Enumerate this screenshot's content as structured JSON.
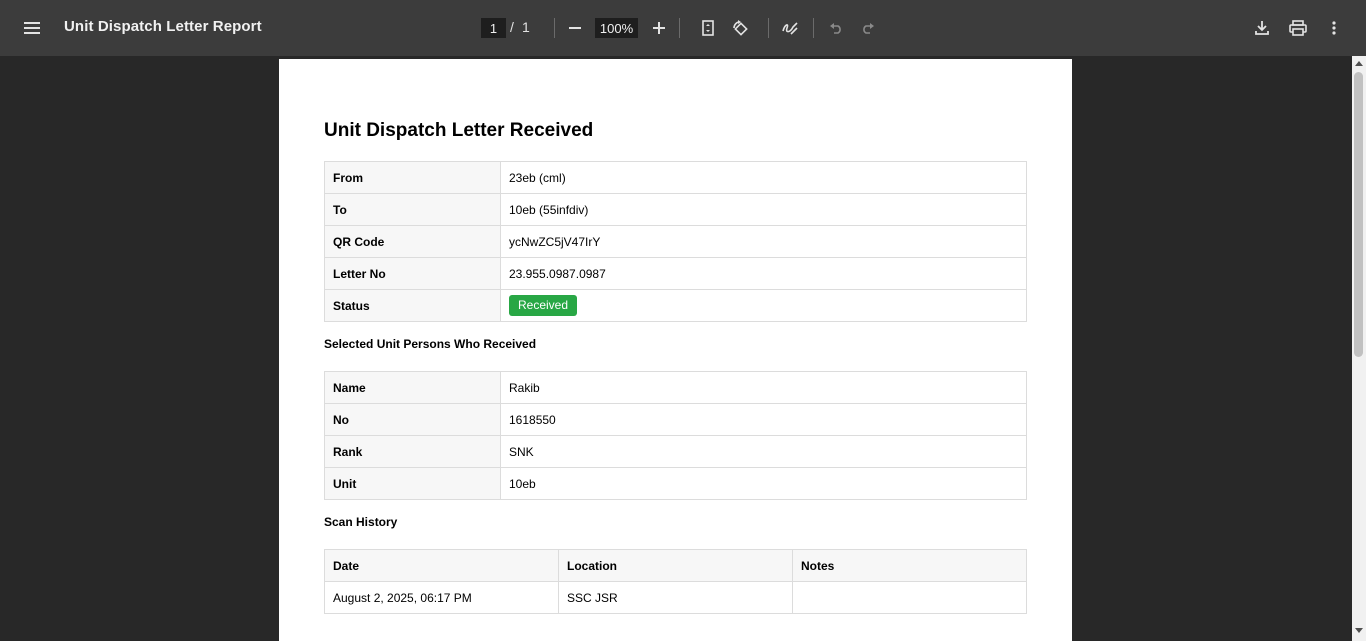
{
  "viewer": {
    "title": "Unit Dispatch Letter Report",
    "page_current": "1",
    "page_separator": "/",
    "page_total": "1",
    "zoom": "100%"
  },
  "report": {
    "title": "Unit Dispatch Letter Received",
    "details": [
      {
        "label": "From",
        "value": "23eb (cml)"
      },
      {
        "label": "To",
        "value": "10eb (55infdiv)"
      },
      {
        "label": "QR Code",
        "value": "ycNwZC5jV47IrY"
      },
      {
        "label": "Letter No",
        "value": "23.955.0987.0987"
      }
    ],
    "status_label": "Status",
    "status_value": "Received",
    "status_color": "#28a745",
    "persons_heading": "Selected Unit Persons Who Received",
    "persons": [
      {
        "label": "Name",
        "value": "Rakib"
      },
      {
        "label": "No",
        "value": "1618550"
      },
      {
        "label": "Rank",
        "value": "SNK"
      },
      {
        "label": "Unit",
        "value": "10eb"
      }
    ],
    "scan_heading": "Scan History",
    "scan_columns": [
      "Date",
      "Location",
      "Notes"
    ],
    "scan_rows": [
      {
        "date": "August 2, 2025, 06:17 PM",
        "location": "SSC JSR",
        "notes": ""
      }
    ]
  },
  "icons": {
    "menu": "menu-icon",
    "zoom_out": "minus-icon",
    "zoom_in": "plus-icon",
    "fit": "fit-page-icon",
    "rotate": "rotate-icon",
    "annotate": "draw-icon",
    "undo": "undo-icon",
    "redo": "redo-icon",
    "download": "download-icon",
    "print": "print-icon",
    "more": "more-vert-icon"
  }
}
